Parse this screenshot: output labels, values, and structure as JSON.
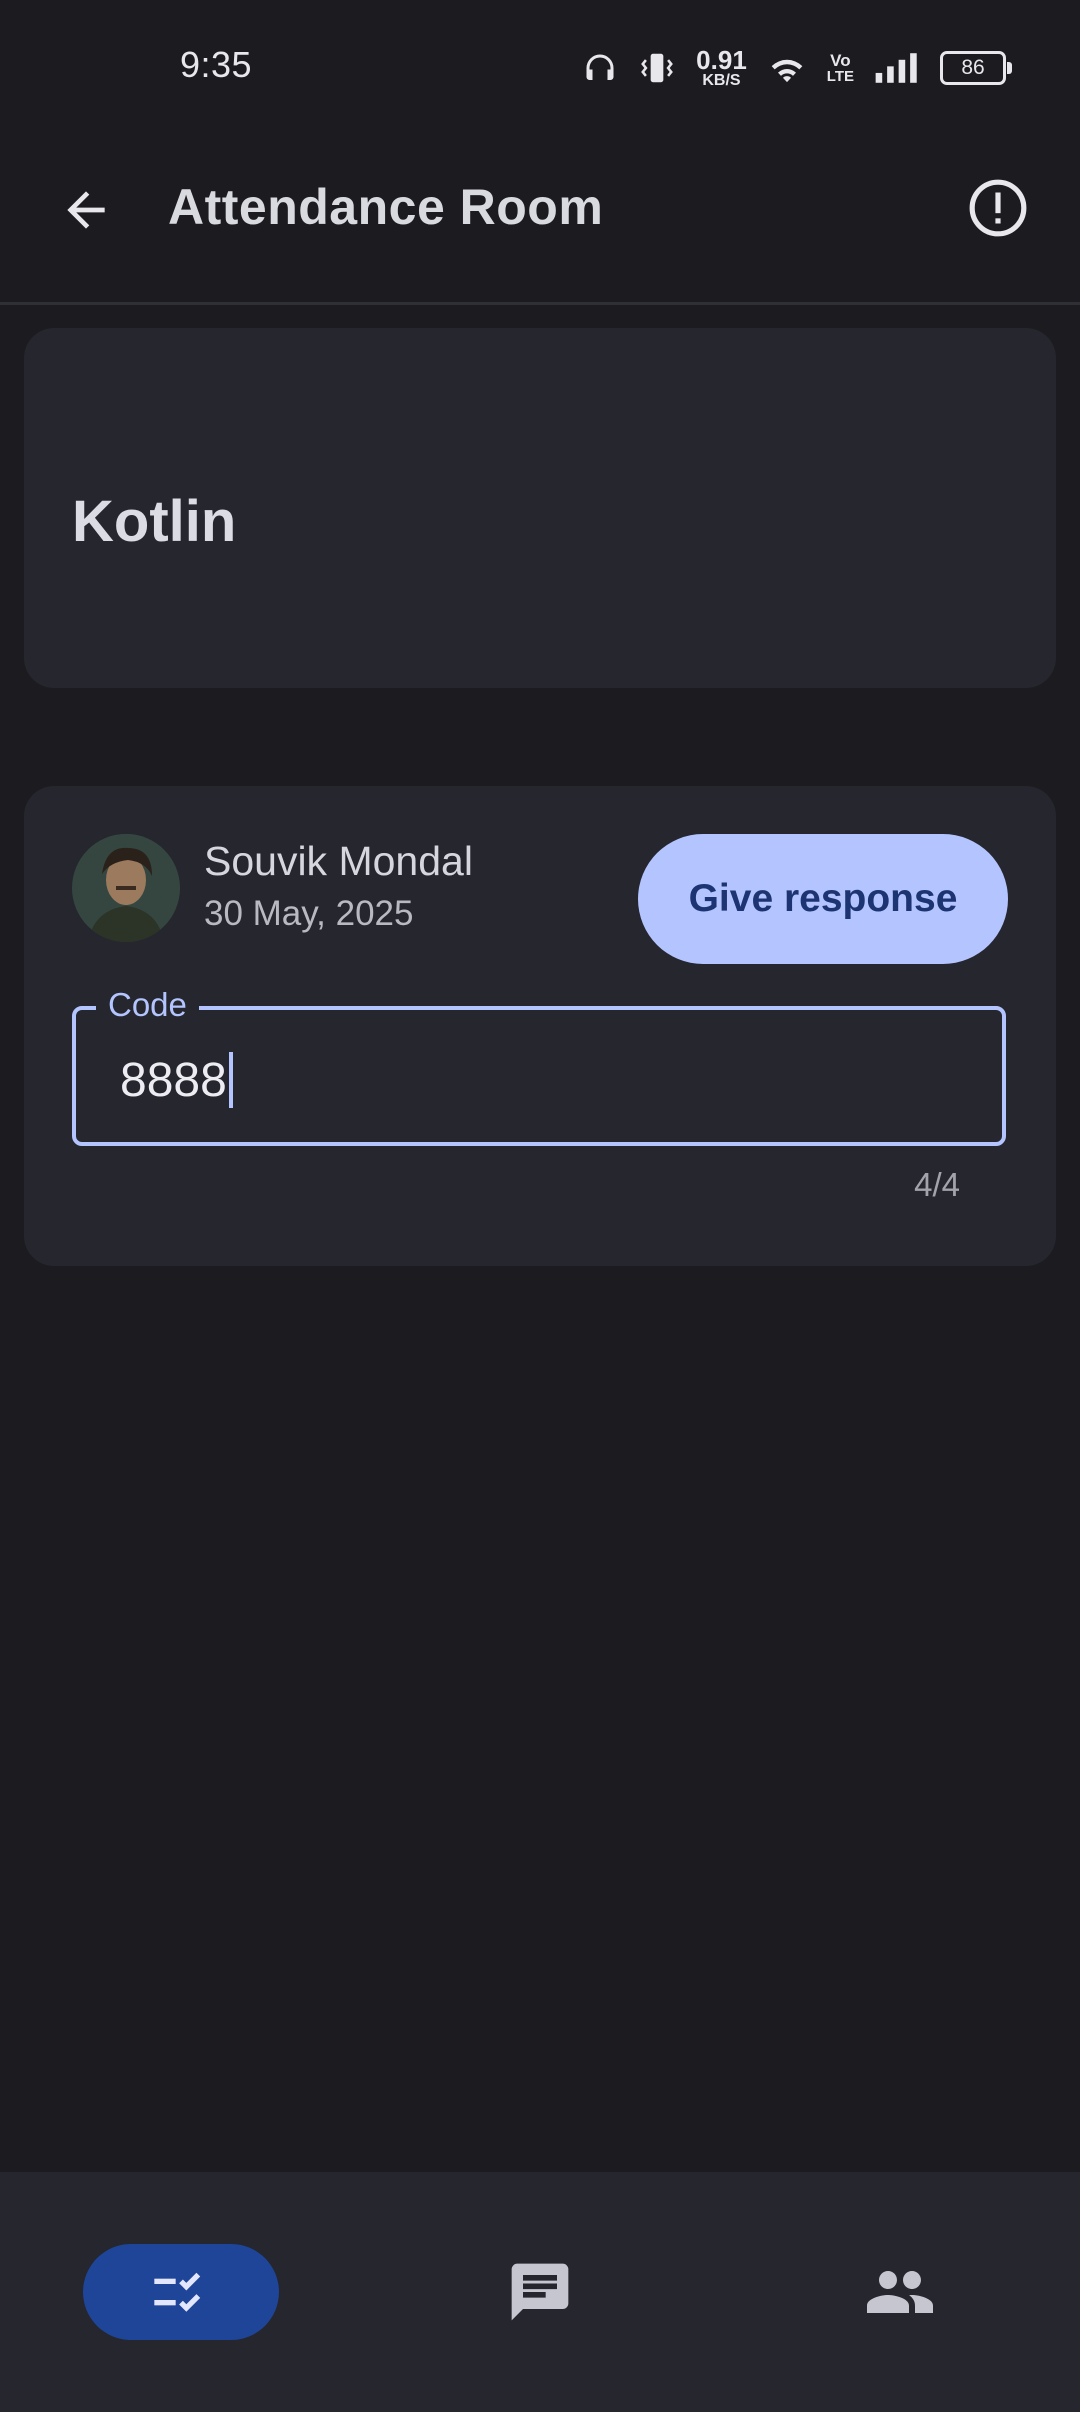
{
  "status_bar": {
    "time": "9:35",
    "net_speed_value": "0.91",
    "net_speed_unit": "KB/S",
    "volte_top": "Vo",
    "volte_bottom": "LTE",
    "battery": "86"
  },
  "app_bar": {
    "title": "Attendance Room",
    "back_icon": "arrow-back-icon",
    "info_icon": "info-icon"
  },
  "class_card": {
    "name": "Kotlin"
  },
  "attendance_post": {
    "author": "Souvik Mondal",
    "date": "30 May, 2025",
    "respond_label": "Give response",
    "code_label": "Code",
    "code_value": "8888",
    "counter": "4/4"
  },
  "bottom_nav": {
    "items": [
      {
        "icon": "checklist-icon",
        "active": true
      },
      {
        "icon": "chat-icon",
        "active": false
      },
      {
        "icon": "people-icon",
        "active": false
      }
    ]
  },
  "colors": {
    "background": "#1b1b20",
    "surface": "#25262e",
    "primary": "#b4c4ff",
    "on_primary": "#1d3473",
    "nav_active": "#1e4598"
  }
}
